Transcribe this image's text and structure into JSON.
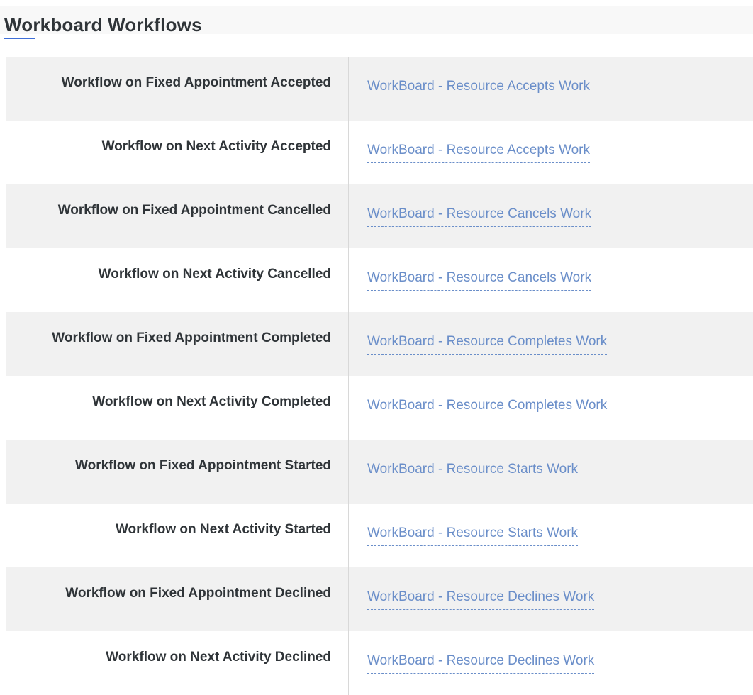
{
  "page": {
    "title": "Workboard Workflows"
  },
  "rows": [
    {
      "label": "Workflow on Fixed Appointment Accepted",
      "value": "WorkBoard - Resource Accepts Work"
    },
    {
      "label": "Workflow on Next Activity Accepted",
      "value": "WorkBoard - Resource Accepts Work"
    },
    {
      "label": "Workflow on Fixed Appointment Cancelled",
      "value": "WorkBoard - Resource Cancels Work"
    },
    {
      "label": "Workflow on Next Activity Cancelled",
      "value": "WorkBoard - Resource Cancels Work"
    },
    {
      "label": "Workflow on Fixed Appointment Completed",
      "value": "WorkBoard - Resource Completes Work"
    },
    {
      "label": "Workflow on Next Activity Completed",
      "value": "WorkBoard - Resource Completes Work"
    },
    {
      "label": "Workflow on Fixed Appointment Started",
      "value": "WorkBoard - Resource Starts Work"
    },
    {
      "label": "Workflow on Next Activity Started",
      "value": "WorkBoard - Resource Starts Work"
    },
    {
      "label": "Workflow on Fixed Appointment Declined",
      "value": "WorkBoard - Resource Declines Work"
    },
    {
      "label": "Workflow on Next Activity Declined",
      "value": "WorkBoard - Resource Declines Work"
    }
  ],
  "colors": {
    "link": "#6a8ec9",
    "label": "#2f3438",
    "row_shaded": "#f1f1f1",
    "accent": "#3f6fd8"
  }
}
